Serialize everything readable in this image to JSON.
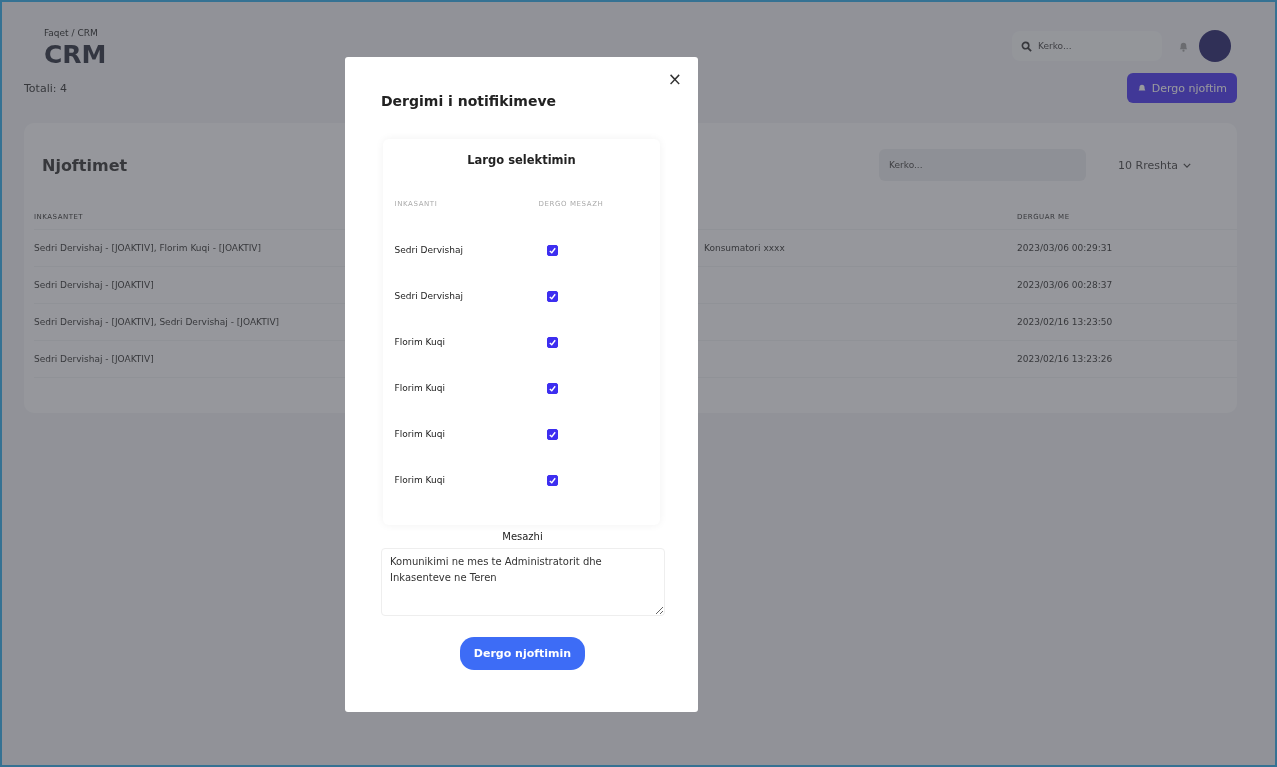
{
  "header": {
    "breadcrumb": "Faqet / CRM",
    "title": "CRM",
    "total": "Totali: 4",
    "search_placeholder": "Kerko...",
    "send_button": "Dergo njoftim"
  },
  "card": {
    "title": "Njoftimet",
    "search_placeholder": "Kerko...",
    "rows_select": "10 Rreshta",
    "columns": [
      {
        "label": "INKASANTET",
        "kind": "first"
      },
      {
        "label": "DERGUAR ME",
        "kind": "last"
      }
    ],
    "rows": [
      {
        "column_1": "Sedri Dervishaj - [JOAKTIV], Florim Kuqi - [JOAKTIV]",
        "column_2": "Konsumatori xxxx",
        "column_3": "2023/03/06 00:29:31"
      },
      {
        "column_1": "Sedri Dervishaj - [JOAKTIV]",
        "column_3": "2023/03/06 00:28:37"
      },
      {
        "column_1": "Sedri Dervishaj - [JOAKTIV], Sedri Dervishaj - [JOAKTIV]",
        "column_3": "2023/02/16 13:23:50"
      },
      {
        "column_1": "Sedri Dervishaj - [JOAKTIV]",
        "column_3": "2023/02/16 13:23:26"
      }
    ]
  },
  "modal": {
    "title": "Dergimi i notifikimeve",
    "close": "×",
    "clear_selection": "Largo selektimin",
    "columns": [
      "INKASANTI",
      "DERGO MESAZH"
    ],
    "recipients": [
      {
        "name": "Sedri Dervishaj",
        "checked": true
      },
      {
        "name": "Sedri Dervishaj",
        "checked": true
      },
      {
        "name": "Florim Kuqi",
        "checked": true
      },
      {
        "name": "Florim Kuqi",
        "checked": true
      },
      {
        "name": "Florim Kuqi",
        "checked": true
      },
      {
        "name": "Florim Kuqi",
        "checked": true
      }
    ],
    "message_label": "Mesazhi",
    "message": "Komunikimi ne mes te Administratorit dhe Inkasenteve ne Teren",
    "submit": "Dergo njoftimin"
  }
}
